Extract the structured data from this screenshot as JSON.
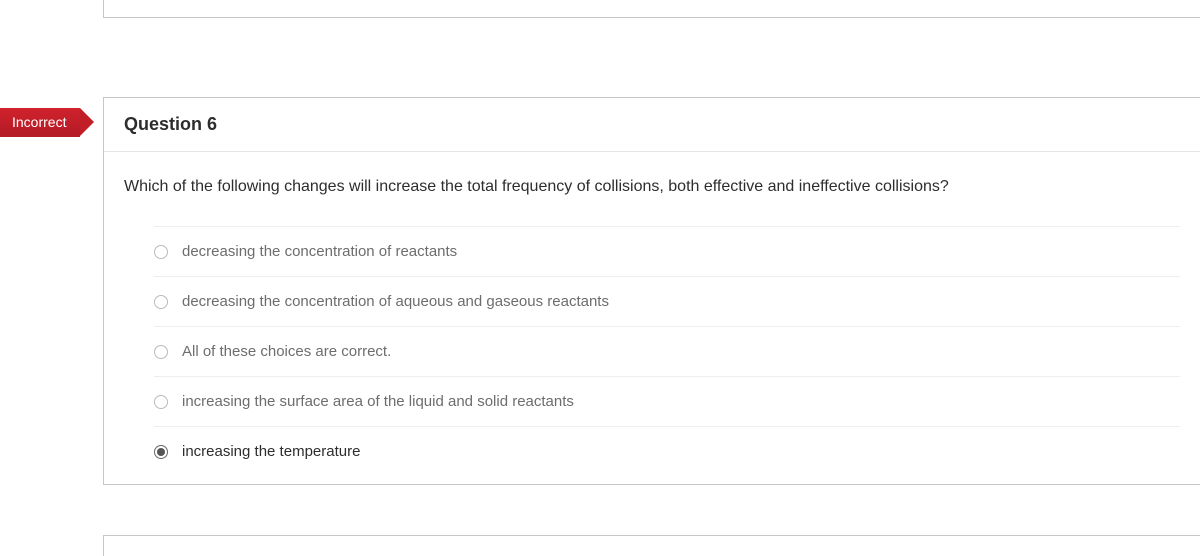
{
  "status": "Incorrect",
  "question": {
    "title": "Question 6",
    "text": "Which of the following changes will increase the total frequency of collisions, both effective and ineffective collisions?",
    "options": [
      {
        "label": "decreasing the concentration of reactants",
        "selected": false
      },
      {
        "label": "decreasing the concentration of aqueous and gaseous reactants",
        "selected": false
      },
      {
        "label": "All of these choices are correct.",
        "selected": false
      },
      {
        "label": "increasing the surface area of the liquid and solid reactants",
        "selected": false
      },
      {
        "label": "increasing the temperature",
        "selected": true
      }
    ]
  }
}
